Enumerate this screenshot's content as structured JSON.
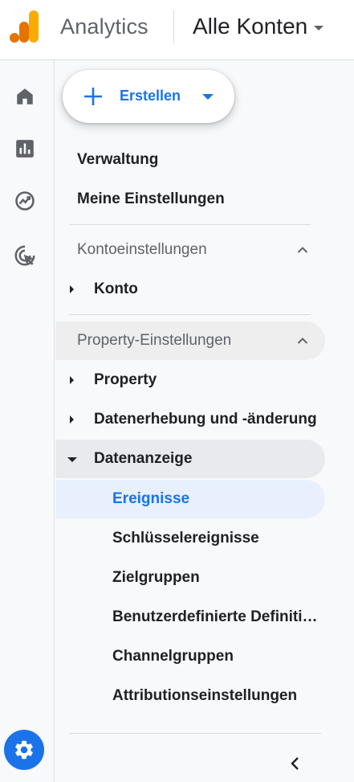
{
  "header": {
    "app_title": "Analytics",
    "account_label": "Alle Konten",
    "logo_colors": [
      "#F9AB00",
      "#E37400"
    ]
  },
  "rail": {
    "items": [
      "home-icon",
      "reports-icon",
      "explore-icon",
      "advertising-icon"
    ],
    "settings_icon": "gear-icon"
  },
  "panel": {
    "create_label": "Erstellen",
    "admin_label": "Verwaltung",
    "my_settings_label": "Meine Einstellungen",
    "account_section": {
      "label": "Kontoeinstellungen",
      "expanded": true,
      "items": [
        {
          "label": "Konto",
          "expanded": false
        }
      ]
    },
    "property_section": {
      "label": "Property-Einstellungen",
      "expanded": true,
      "items": [
        {
          "label": "Property",
          "expanded": false
        },
        {
          "label": "Datenerhebung und -änderung",
          "expanded": false
        },
        {
          "label": "Datenanzeige",
          "expanded": true
        }
      ],
      "sub_items": [
        {
          "label": "Ereignisse",
          "active": true
        },
        {
          "label": "Schlüsselereignisse",
          "active": false
        },
        {
          "label": "Zielgruppen",
          "active": false
        },
        {
          "label": "Benutzerdefinierte Definitionen",
          "active": false
        },
        {
          "label": "Channelgruppen",
          "active": false
        },
        {
          "label": "Attributionseinstellungen",
          "active": false
        }
      ]
    },
    "collapse_icon": "chevron-left-icon"
  },
  "colors": {
    "accent": "#1a73e8",
    "active_bg": "#e8f0fe",
    "section_hover_bg": "#eeeeee"
  }
}
